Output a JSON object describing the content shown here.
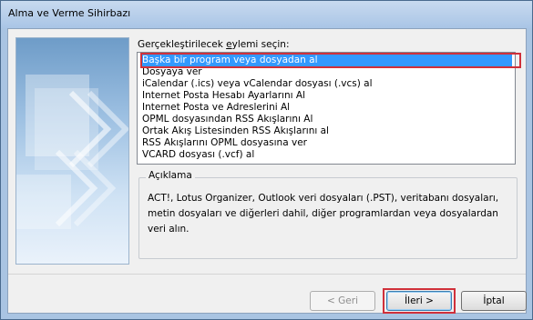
{
  "window": {
    "title": "Alma ve Verme Sihirbazı"
  },
  "prompt": {
    "label_pre": "Gerçekleştirilecek ",
    "label_underlined": "e",
    "label_post": "ylemi seçin:"
  },
  "actions": [
    "Başka bir program veya dosyadan al",
    "Dosyaya ver",
    "iCalendar (.ics) veya vCalendar dosyası (.vcs) al",
    "Internet Posta Hesabı Ayarlarını Al",
    "Internet Posta ve Adreslerini Al",
    "OPML dosyasından RSS Akışlarını Al",
    "Ortak Akış Listesinden RSS Akışlarını al",
    "RSS Akışlarını OPML dosyasına ver",
    "VCARD dosyası (.vcf) al"
  ],
  "selected_index": 0,
  "description": {
    "label": "Açıklama",
    "text": "ACT!, Lotus Organizer, Outlook veri dosyaları (.PST), veritabanı dosyaları, metin dosyaları ve diğerleri dahil, diğer programlardan veya dosyalardan veri alın."
  },
  "buttons": {
    "back": "< Geri",
    "next": "İleri >",
    "cancel": "İptal"
  },
  "colors": {
    "selection": "#3399ff",
    "highlight": "#d0303a"
  }
}
